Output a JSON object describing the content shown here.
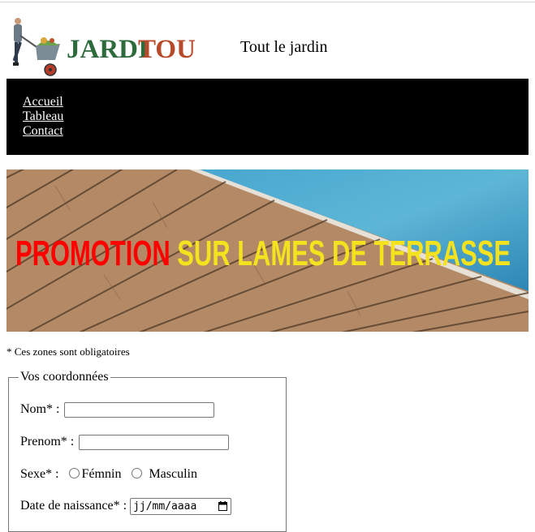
{
  "header": {
    "brand": {
      "part1": "JARDI",
      "part2": "TOU"
    },
    "tagline": "Tout le jardin"
  },
  "nav": {
    "items": [
      {
        "label": "Accueil"
      },
      {
        "label": "Tableau"
      },
      {
        "label": "Contact"
      }
    ]
  },
  "banner": {
    "text_part1": "PROMOTION",
    "text_part2": " SUR LAMES DE TERRASSE",
    "colors": {
      "part1": "#ff0000",
      "part2": "#f3e21d"
    }
  },
  "form": {
    "required_note": "* Ces zones sont obligatoires",
    "legend": "Vos coordonnées",
    "nom_label": "Nom* :",
    "prenom_label": "Prenom* :",
    "sexe_label": "Sexe* :",
    "sexe_options": [
      "Fémnin",
      "Masculin"
    ],
    "dob_label": "Date de naissance* :",
    "dob_placeholder": "jj/mm/aaaa"
  }
}
